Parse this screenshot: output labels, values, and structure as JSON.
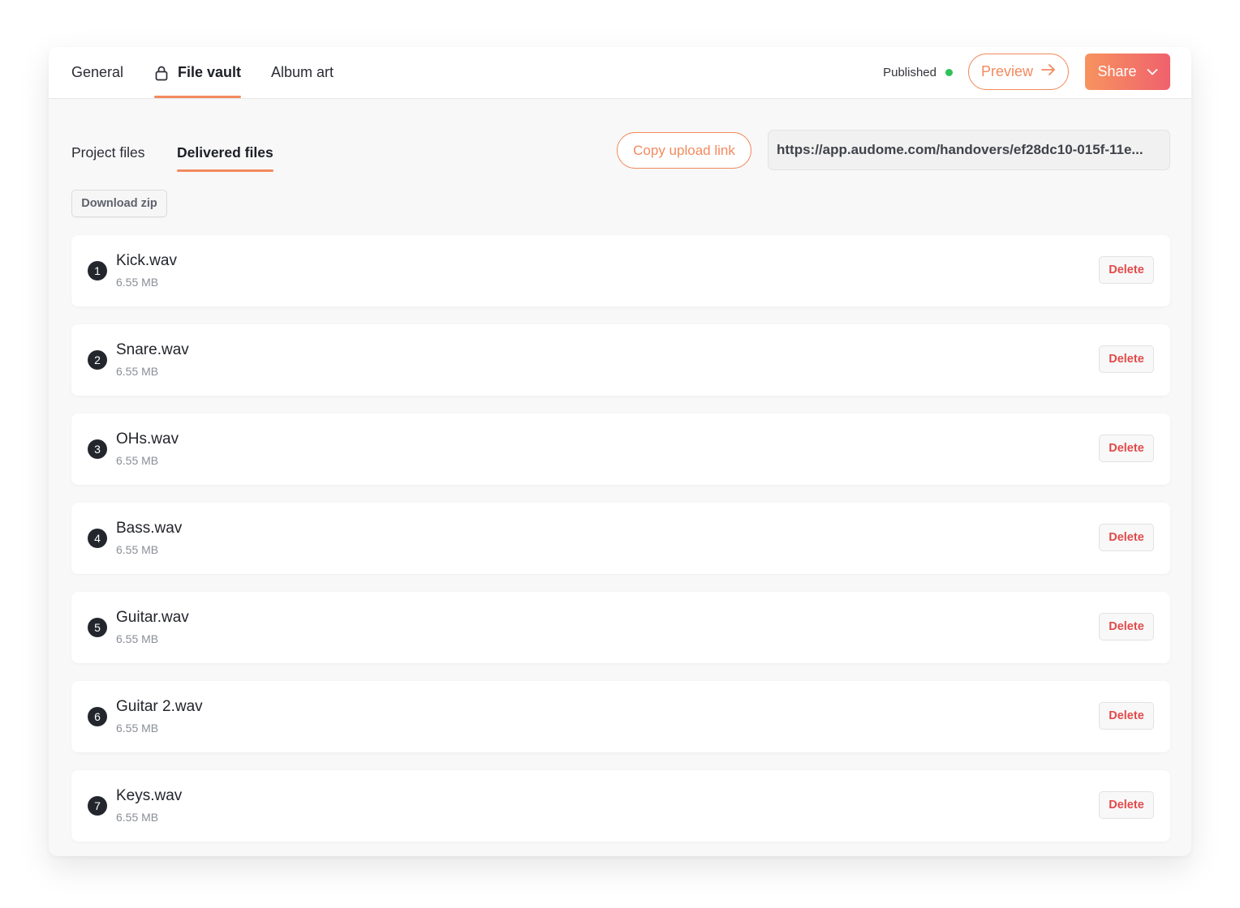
{
  "colors": {
    "accent": "#f28a5f",
    "share_gradient_start": "#f7935f",
    "share_gradient_end": "#f0616d",
    "published_dot": "#2fc15a",
    "delete": "#e24a4a"
  },
  "header": {
    "tabs": [
      {
        "label": "General",
        "active": false
      },
      {
        "label": "File vault",
        "active": true,
        "icon": "lock-icon"
      },
      {
        "label": "Album art",
        "active": false
      }
    ],
    "status_label": "Published",
    "preview_label": "Preview",
    "preview_icon": "arrow-right-icon",
    "share_label": "Share",
    "share_icon": "chevron-down-icon"
  },
  "subtabs": [
    {
      "label": "Project files",
      "active": false
    },
    {
      "label": "Delivered files",
      "active": true
    }
  ],
  "copy_link_label": "Copy upload link",
  "upload_url": "https://app.audome.com/handovers/ef28dc10-015f-11e...",
  "download_zip_label": "Download zip",
  "files": [
    {
      "index": "1",
      "name": "Kick.wav",
      "size": "6.55 MB",
      "action": "Delete"
    },
    {
      "index": "2",
      "name": "Snare.wav",
      "size": "6.55 MB",
      "action": "Delete"
    },
    {
      "index": "3",
      "name": "OHs.wav",
      "size": "6.55 MB",
      "action": "Delete"
    },
    {
      "index": "4",
      "name": "Bass.wav",
      "size": "6.55 MB",
      "action": "Delete"
    },
    {
      "index": "5",
      "name": "Guitar.wav",
      "size": "6.55 MB",
      "action": "Delete"
    },
    {
      "index": "6",
      "name": "Guitar 2.wav",
      "size": "6.55 MB",
      "action": "Delete"
    },
    {
      "index": "7",
      "name": "Keys.wav",
      "size": "6.55 MB",
      "action": "Delete"
    }
  ]
}
